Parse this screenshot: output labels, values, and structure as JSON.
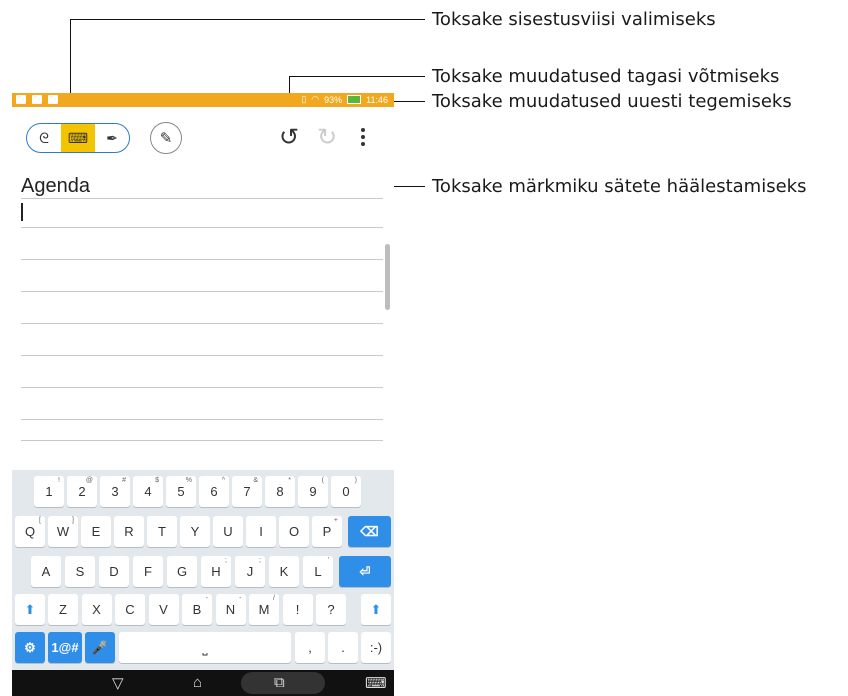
{
  "callouts": {
    "input_mode": "Toksake sisestusviisi valimiseks",
    "undo": "Toksake muudatused tagasi võtmiseks",
    "redo": "Toksake muudatused uuesti tegemiseks",
    "settings": "Toksake märkmiku sätete häälestamiseks"
  },
  "status_bar": {
    "battery": "93%",
    "time": "11:46"
  },
  "toolbar": {
    "mode_handwrite": "ᘓ",
    "mode_keyboard": "⌨",
    "mode_pen": "✒",
    "edit": "✎",
    "undo": "↺",
    "redo": "↻"
  },
  "note": {
    "title": "Agenda"
  },
  "keyboard": {
    "row1": [
      {
        "k": "1",
        "h": "!"
      },
      {
        "k": "2",
        "h": "@"
      },
      {
        "k": "3",
        "h": "#"
      },
      {
        "k": "4",
        "h": "$"
      },
      {
        "k": "5",
        "h": "%"
      },
      {
        "k": "6",
        "h": "^"
      },
      {
        "k": "7",
        "h": "&"
      },
      {
        "k": "8",
        "h": "*"
      },
      {
        "k": "9",
        "h": "("
      },
      {
        "k": "0",
        "h": ")"
      }
    ],
    "row2": [
      {
        "k": "Q",
        "h": "["
      },
      {
        "k": "W",
        "h": "]"
      },
      {
        "k": "E",
        "h": ""
      },
      {
        "k": "R",
        "h": ""
      },
      {
        "k": "T",
        "h": ""
      },
      {
        "k": "Y",
        "h": ""
      },
      {
        "k": "U",
        "h": ""
      },
      {
        "k": "I",
        "h": ""
      },
      {
        "k": "O",
        "h": ""
      },
      {
        "k": "P",
        "h": "+"
      }
    ],
    "backspace": "⌫",
    "row3": [
      {
        "k": "A",
        "h": ""
      },
      {
        "k": "S",
        "h": ""
      },
      {
        "k": "D",
        "h": ""
      },
      {
        "k": "F",
        "h": ""
      },
      {
        "k": "G",
        "h": ""
      },
      {
        "k": "H",
        "h": ";"
      },
      {
        "k": "J",
        "h": ";"
      },
      {
        "k": "K",
        "h": ""
      },
      {
        "k": "L",
        "h": "'"
      }
    ],
    "enter": "⏎",
    "shift": "⬆",
    "row4": [
      {
        "k": "Z",
        "h": ""
      },
      {
        "k": "X",
        "h": ""
      },
      {
        "k": "C",
        "h": ""
      },
      {
        "k": "V",
        "h": ""
      },
      {
        "k": "B",
        "h": "-"
      },
      {
        "k": "N",
        "h": "-"
      },
      {
        "k": "M",
        "h": "/"
      },
      {
        "k": "!",
        "h": ""
      },
      {
        "k": "?",
        "h": ""
      }
    ],
    "settings_key": "⚙",
    "symbols_key": "1@#",
    "mic_key": "🎤",
    "space_key": "⎵",
    "comma_key": ",",
    "period_key": ".",
    "smiley_key": ":-)"
  },
  "navbar": {
    "back": "▽",
    "home": "⌂",
    "recents": "⧉",
    "keyboard": "⌨"
  }
}
